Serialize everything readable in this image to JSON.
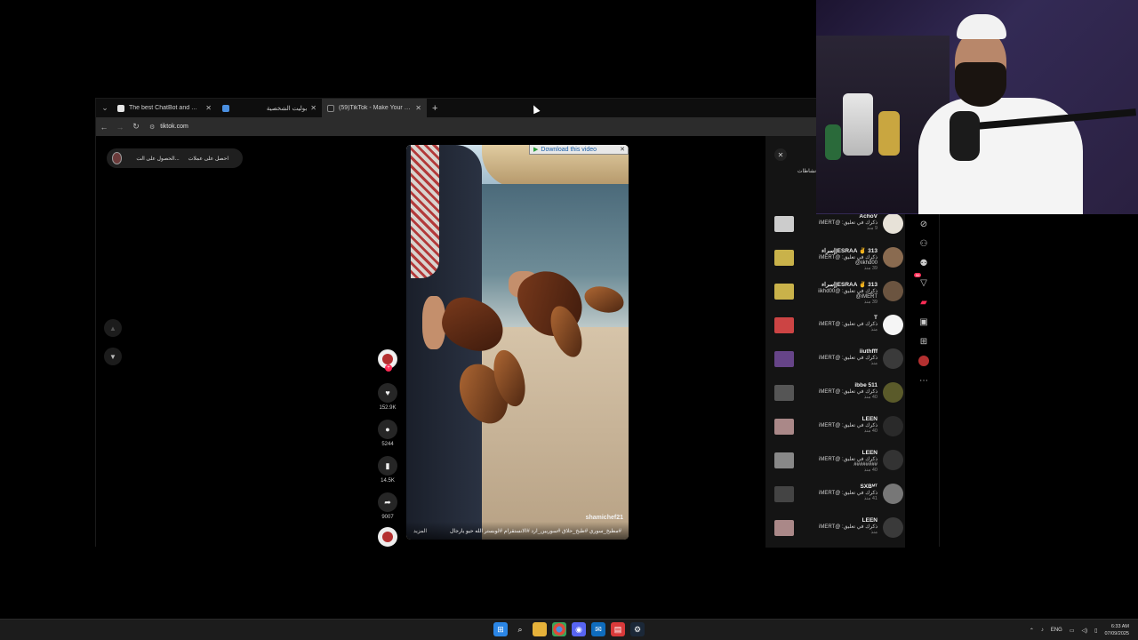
{
  "browser": {
    "tabs": [
      {
        "label": "The best ChatBot and Widgets",
        "active": false,
        "favicon_color": "#e6e6e6"
      },
      {
        "label": "بوليت الشخصية",
        "active": false,
        "favicon_color": "#4a8fe0"
      },
      {
        "label": "(59)TikTok - Make Your Day",
        "active": true,
        "favicon_color": "#222222"
      }
    ],
    "tab_close": "✕",
    "new_tab": "+",
    "url": "tiktok.com"
  },
  "tiktok": {
    "top_buttons": [
      "احصل على عملات",
      "الحصول على الت..."
    ],
    "download_banner": "Download this video",
    "watermark": "shamichef21",
    "caption": "#مطبخ_سوري  #طبخ_حلاق  #سوريين_ارد  #الانستقرام #لوبستر  الله حيو يارجال",
    "caption_more": "المزيد",
    "likes": "152.9K",
    "comments": "5244",
    "saves": "14.5K",
    "shares": "9007",
    "notifications_title": "نشاطات",
    "notifications": [
      {
        "name": "AchoV",
        "line": "ذكرك في تعليق: @iMERT",
        "meta": "9 منذ"
      },
      {
        "name": "313 ✌ ESRAA|إسراء",
        "line": "ذكرك في تعليق: @iMERT @iikhd00",
        "meta": "39 منذ"
      },
      {
        "name": "313 ✌ ESRAA|إسراء",
        "line": "ذكرك في تعليق: @iikhd00 @iMERT",
        "meta": "39 منذ"
      },
      {
        "name": "T",
        "line": "ذكرك في تعليق: @iMERT",
        "meta": "منذ"
      },
      {
        "name": "iiuthfff",
        "line": "ذكرك في تعليق: @iMERT",
        "meta": "منذ"
      },
      {
        "name": "ibbe 511",
        "line": "ذكرك في تعليق: @iMERT",
        "meta": "40 منذ"
      },
      {
        "name": "LEEN",
        "line": "ذكرك في تعليق: @iMERT",
        "meta": "40 منذ"
      },
      {
        "name": "LEEN",
        "line": "ذكرك في تعليق: @iMERT ########",
        "meta": "40 منذ"
      },
      {
        "name": "SXBᴹᵀ",
        "line": "ذكرك في تعليق: @iMERT",
        "meta": "41 منذ"
      },
      {
        "name": "LEEN",
        "line": "ذكرك في تعليق: @iMERT",
        "meta": "منذ"
      }
    ],
    "rail_badge": "56"
  },
  "taskbar": {
    "language": "ENG",
    "time": "6:33 AM",
    "date": "07/09/2025"
  },
  "colors": {
    "tiktok_red": "#fe2c55",
    "tab_active": "#2c2c2c",
    "panel_bg": "#141414"
  }
}
